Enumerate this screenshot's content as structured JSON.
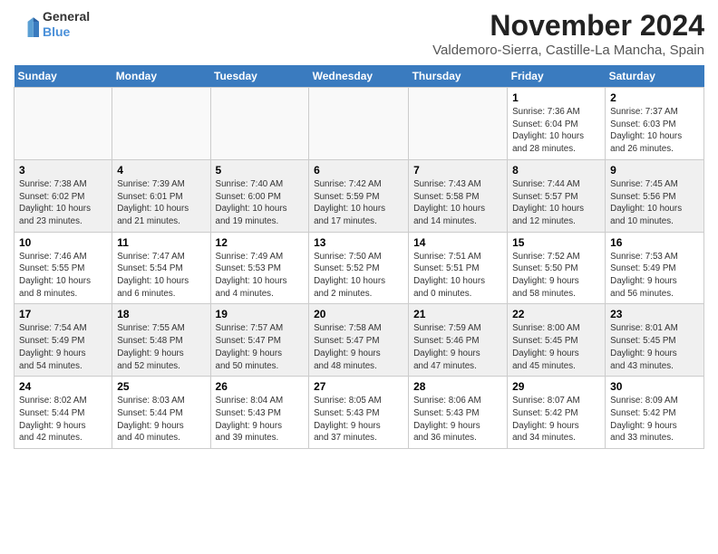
{
  "header": {
    "logo_general": "General",
    "logo_blue": "Blue",
    "month": "November 2024",
    "location": "Valdemoro-Sierra, Castille-La Mancha, Spain"
  },
  "weekdays": [
    "Sunday",
    "Monday",
    "Tuesday",
    "Wednesday",
    "Thursday",
    "Friday",
    "Saturday"
  ],
  "weeks": [
    [
      {
        "day": "",
        "info": ""
      },
      {
        "day": "",
        "info": ""
      },
      {
        "day": "",
        "info": ""
      },
      {
        "day": "",
        "info": ""
      },
      {
        "day": "",
        "info": ""
      },
      {
        "day": "1",
        "info": "Sunrise: 7:36 AM\nSunset: 6:04 PM\nDaylight: 10 hours\nand 28 minutes."
      },
      {
        "day": "2",
        "info": "Sunrise: 7:37 AM\nSunset: 6:03 PM\nDaylight: 10 hours\nand 26 minutes."
      }
    ],
    [
      {
        "day": "3",
        "info": "Sunrise: 7:38 AM\nSunset: 6:02 PM\nDaylight: 10 hours\nand 23 minutes."
      },
      {
        "day": "4",
        "info": "Sunrise: 7:39 AM\nSunset: 6:01 PM\nDaylight: 10 hours\nand 21 minutes."
      },
      {
        "day": "5",
        "info": "Sunrise: 7:40 AM\nSunset: 6:00 PM\nDaylight: 10 hours\nand 19 minutes."
      },
      {
        "day": "6",
        "info": "Sunrise: 7:42 AM\nSunset: 5:59 PM\nDaylight: 10 hours\nand 17 minutes."
      },
      {
        "day": "7",
        "info": "Sunrise: 7:43 AM\nSunset: 5:58 PM\nDaylight: 10 hours\nand 14 minutes."
      },
      {
        "day": "8",
        "info": "Sunrise: 7:44 AM\nSunset: 5:57 PM\nDaylight: 10 hours\nand 12 minutes."
      },
      {
        "day": "9",
        "info": "Sunrise: 7:45 AM\nSunset: 5:56 PM\nDaylight: 10 hours\nand 10 minutes."
      }
    ],
    [
      {
        "day": "10",
        "info": "Sunrise: 7:46 AM\nSunset: 5:55 PM\nDaylight: 10 hours\nand 8 minutes."
      },
      {
        "day": "11",
        "info": "Sunrise: 7:47 AM\nSunset: 5:54 PM\nDaylight: 10 hours\nand 6 minutes."
      },
      {
        "day": "12",
        "info": "Sunrise: 7:49 AM\nSunset: 5:53 PM\nDaylight: 10 hours\nand 4 minutes."
      },
      {
        "day": "13",
        "info": "Sunrise: 7:50 AM\nSunset: 5:52 PM\nDaylight: 10 hours\nand 2 minutes."
      },
      {
        "day": "14",
        "info": "Sunrise: 7:51 AM\nSunset: 5:51 PM\nDaylight: 10 hours\nand 0 minutes."
      },
      {
        "day": "15",
        "info": "Sunrise: 7:52 AM\nSunset: 5:50 PM\nDaylight: 9 hours\nand 58 minutes."
      },
      {
        "day": "16",
        "info": "Sunrise: 7:53 AM\nSunset: 5:49 PM\nDaylight: 9 hours\nand 56 minutes."
      }
    ],
    [
      {
        "day": "17",
        "info": "Sunrise: 7:54 AM\nSunset: 5:49 PM\nDaylight: 9 hours\nand 54 minutes."
      },
      {
        "day": "18",
        "info": "Sunrise: 7:55 AM\nSunset: 5:48 PM\nDaylight: 9 hours\nand 52 minutes."
      },
      {
        "day": "19",
        "info": "Sunrise: 7:57 AM\nSunset: 5:47 PM\nDaylight: 9 hours\nand 50 minutes."
      },
      {
        "day": "20",
        "info": "Sunrise: 7:58 AM\nSunset: 5:47 PM\nDaylight: 9 hours\nand 48 minutes."
      },
      {
        "day": "21",
        "info": "Sunrise: 7:59 AM\nSunset: 5:46 PM\nDaylight: 9 hours\nand 47 minutes."
      },
      {
        "day": "22",
        "info": "Sunrise: 8:00 AM\nSunset: 5:45 PM\nDaylight: 9 hours\nand 45 minutes."
      },
      {
        "day": "23",
        "info": "Sunrise: 8:01 AM\nSunset: 5:45 PM\nDaylight: 9 hours\nand 43 minutes."
      }
    ],
    [
      {
        "day": "24",
        "info": "Sunrise: 8:02 AM\nSunset: 5:44 PM\nDaylight: 9 hours\nand 42 minutes."
      },
      {
        "day": "25",
        "info": "Sunrise: 8:03 AM\nSunset: 5:44 PM\nDaylight: 9 hours\nand 40 minutes."
      },
      {
        "day": "26",
        "info": "Sunrise: 8:04 AM\nSunset: 5:43 PM\nDaylight: 9 hours\nand 39 minutes."
      },
      {
        "day": "27",
        "info": "Sunrise: 8:05 AM\nSunset: 5:43 PM\nDaylight: 9 hours\nand 37 minutes."
      },
      {
        "day": "28",
        "info": "Sunrise: 8:06 AM\nSunset: 5:43 PM\nDaylight: 9 hours\nand 36 minutes."
      },
      {
        "day": "29",
        "info": "Sunrise: 8:07 AM\nSunset: 5:42 PM\nDaylight: 9 hours\nand 34 minutes."
      },
      {
        "day": "30",
        "info": "Sunrise: 8:09 AM\nSunset: 5:42 PM\nDaylight: 9 hours\nand 33 minutes."
      }
    ]
  ]
}
